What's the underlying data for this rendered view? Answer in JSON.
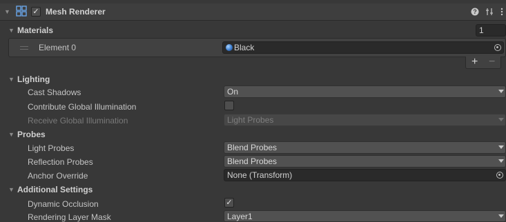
{
  "component": {
    "title": "Mesh Renderer",
    "enabled_check": "✓",
    "help_icon": "help-icon",
    "presets_icon": "presets-icon",
    "menu_icon": "kebab-menu-icon"
  },
  "materials": {
    "label": "Materials",
    "size": "1",
    "element_label": "Element 0",
    "element_value": "Black",
    "add_button": "+",
    "remove_button": "−"
  },
  "lighting": {
    "label": "Lighting",
    "cast_shadows_label": "Cast Shadows",
    "cast_shadows_value": "On",
    "contribute_gi_label": "Contribute Global Illumination",
    "receive_gi_label": "Receive Global Illumination",
    "receive_gi_value": "Light Probes"
  },
  "probes": {
    "label": "Probes",
    "light_probes_label": "Light Probes",
    "light_probes_value": "Blend Probes",
    "reflection_probes_label": "Reflection Probes",
    "reflection_probes_value": "Blend Probes",
    "anchor_override_label": "Anchor Override",
    "anchor_override_value": "None (Transform)"
  },
  "additional": {
    "label": "Additional Settings",
    "dynamic_occlusion_label": "Dynamic Occlusion",
    "dynamic_occlusion_check": "✓",
    "rendering_layer_mask_label": "Rendering Layer Mask",
    "rendering_layer_mask_value": "Layer1"
  },
  "colors": {
    "background": "#383838",
    "field_dark": "#2a2a2a",
    "dropdown": "#515151",
    "text": "#c4c4c4"
  }
}
